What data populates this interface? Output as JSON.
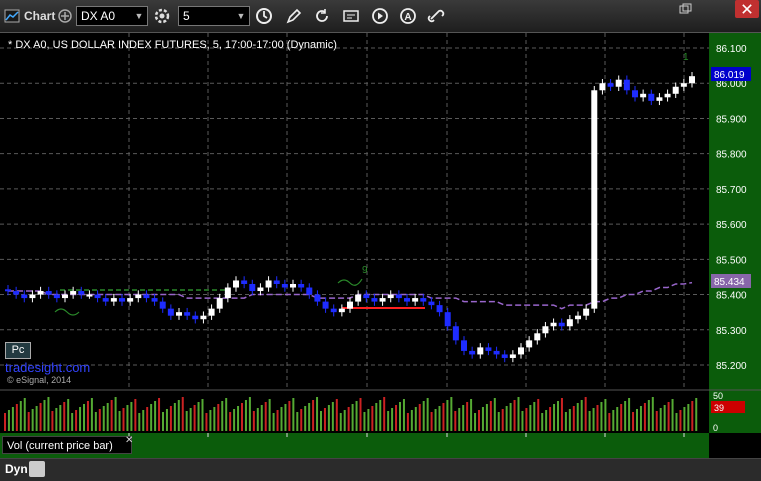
{
  "toolbar": {
    "title": "Chart",
    "symbol": "DX A0",
    "interval": "5",
    "icons": [
      "chart-icon",
      "settings-gear-icon",
      "clock-icon",
      "pencil-icon",
      "refresh-icon",
      "quote-icon",
      "play-icon",
      "alert-icon",
      "link-icon"
    ]
  },
  "window": {
    "icons": [
      "restore-window-icon",
      "close-window-icon"
    ]
  },
  "chart": {
    "heading": "* DX A0, US DOLLAR INDEX FUTURES, 5, 17:00-17:00 (Dynamic)",
    "badge": "Pc",
    "brand": "tradesight.com",
    "copyright": "© eSignal, 2014",
    "last_price": "86.019",
    "ma_value": "85.434",
    "top_marker": "1",
    "annot_label": "9",
    "x_ticks": [
      "02:00",
      "04:00",
      "06:00",
      "08:00",
      "10:00",
      "12:00",
      "14:00",
      "16:00"
    ],
    "colors": {
      "up": "#ffffff",
      "down": "#1e2cff",
      "ma": "#9966cc",
      "grid": "#5a5a5a",
      "axis_bg": "#0b5c0b",
      "price_tag": "#0000cc",
      "ma_tag": "#8866aa"
    }
  },
  "chart_data": {
    "type": "candlestick",
    "y_ticks": [
      86.1,
      86.0,
      85.9,
      85.8,
      85.7,
      85.6,
      85.5,
      85.4,
      85.3,
      85.2
    ],
    "y_range": [
      85.15,
      86.12
    ],
    "x_ticks": [
      "02:00",
      "04:00",
      "06:00",
      "08:00",
      "10:00",
      "12:00",
      "14:00",
      "16:00"
    ],
    "close_series": [
      85.41,
      85.4,
      85.39,
      85.4,
      85.41,
      85.4,
      85.39,
      85.4,
      85.41,
      85.4,
      85.4,
      85.39,
      85.38,
      85.39,
      85.38,
      85.39,
      85.4,
      85.39,
      85.38,
      85.36,
      85.34,
      85.35,
      85.34,
      85.33,
      85.34,
      85.36,
      85.39,
      85.42,
      85.44,
      85.43,
      85.41,
      85.42,
      85.44,
      85.43,
      85.42,
      85.43,
      85.42,
      85.4,
      85.38,
      85.36,
      85.35,
      85.36,
      85.38,
      85.4,
      85.39,
      85.38,
      85.39,
      85.4,
      85.39,
      85.38,
      85.39,
      85.38,
      85.37,
      85.35,
      85.31,
      85.27,
      85.24,
      85.23,
      85.25,
      85.24,
      85.23,
      85.22,
      85.23,
      85.25,
      85.27,
      85.29,
      85.31,
      85.32,
      85.31,
      85.33,
      85.34,
      85.36,
      85.98,
      86.0,
      85.99,
      86.01,
      85.98,
      85.96,
      85.97,
      85.95,
      85.96,
      85.97,
      85.99,
      86.0,
      86.02
    ],
    "ma_series": [
      85.41,
      85.41,
      85.41,
      85.41,
      85.41,
      85.4,
      85.4,
      85.4,
      85.4,
      85.4,
      85.4,
      85.4,
      85.4,
      85.4,
      85.4,
      85.4,
      85.4,
      85.4,
      85.4,
      85.4,
      85.4,
      85.4,
      85.39,
      85.39,
      85.39,
      85.39,
      85.39,
      85.39,
      85.39,
      85.39,
      85.4,
      85.4,
      85.4,
      85.4,
      85.4,
      85.4,
      85.4,
      85.4,
      85.39,
      85.39,
      85.39,
      85.39,
      85.39,
      85.4,
      85.4,
      85.4,
      85.4,
      85.4,
      85.4,
      85.4,
      85.4,
      85.4,
      85.39,
      85.39,
      85.39,
      85.39,
      85.38,
      85.38,
      85.38,
      85.38,
      85.38,
      85.37,
      85.37,
      85.37,
      85.37,
      85.37,
      85.37,
      85.37,
      85.36,
      85.37,
      85.37,
      85.37,
      85.38,
      85.38,
      85.39,
      85.39,
      85.4,
      85.4,
      85.41,
      85.41,
      85.42,
      85.42,
      85.43,
      85.43,
      85.434
    ],
    "volume_axis": [
      50,
      0
    ],
    "volume_value": "39",
    "volume_label": "Vol (current price bar)"
  }
}
